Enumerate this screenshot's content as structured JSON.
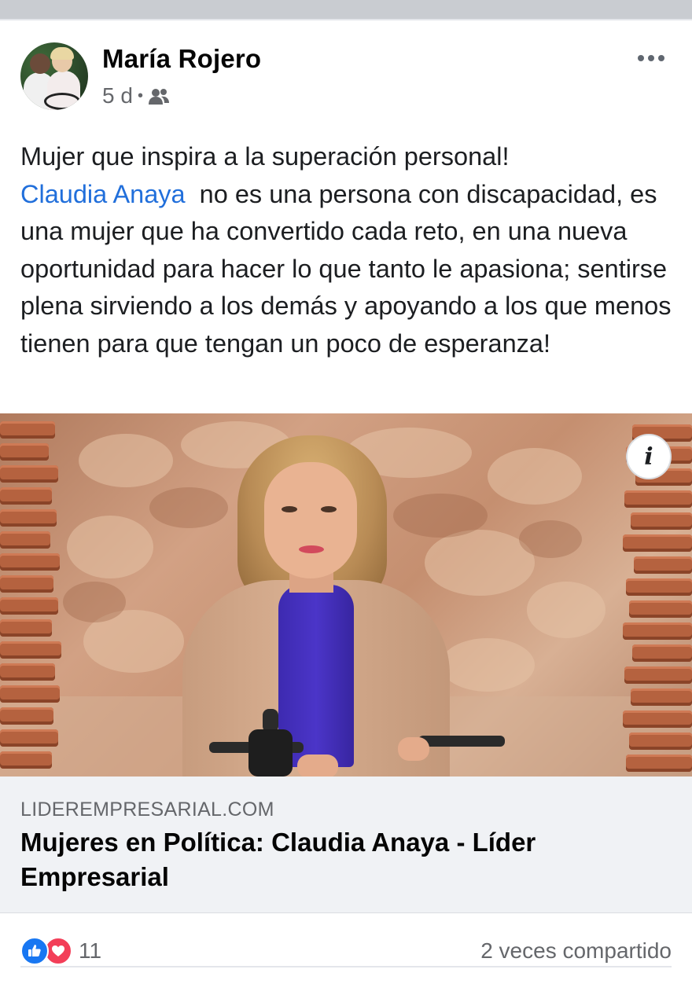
{
  "post": {
    "author": "María Rojero",
    "time": "5 d",
    "separator": "•",
    "audience_icon": "friends-icon",
    "more_icon": "more-options-icon",
    "text_before_mention": "Mujer que inspira a la superación personal!\n",
    "mention": "Claudia Anaya",
    "text_after_mention": "  no es una persona con discapacidad, es una mujer que ha convertido cada reto, en una nueva oportunidad para hacer lo que tanto le apasiona; sentirse plena sirviendo a los demás y apoyando a los que menos tienen para que tengan un poco de esperanza!"
  },
  "link_preview": {
    "info_icon": "i",
    "domain": "LIDEREMPRESARIAL.COM",
    "title": "Mujeres en Política: Claudia Anaya - Líder Empresarial"
  },
  "engagement": {
    "reaction_icons": [
      "like-icon",
      "love-icon"
    ],
    "reaction_count": "11",
    "shares": "2 veces compartido"
  },
  "colors": {
    "mention": "#216fdb",
    "like": "#1877f2",
    "love": "#f33e58",
    "secondary_text": "#65676b"
  }
}
